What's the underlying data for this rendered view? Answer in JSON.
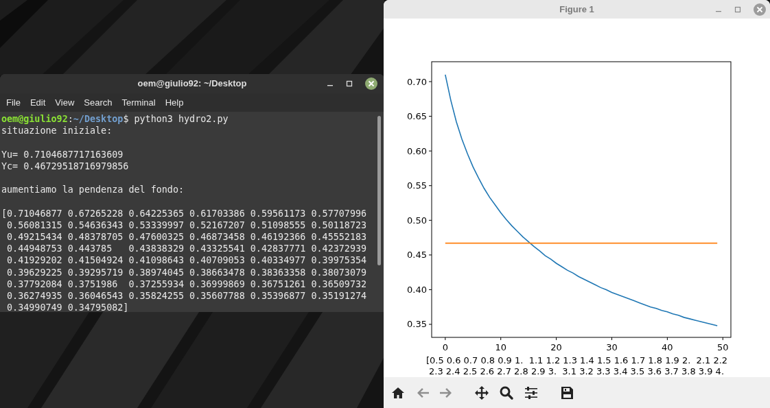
{
  "terminal": {
    "window_title": "oem@giulio92: ~/Desktop",
    "menu": [
      "File",
      "Edit",
      "View",
      "Search",
      "Terminal",
      "Help"
    ],
    "prompt": {
      "user": "oem@giulio92",
      "separator": ":",
      "path": "~/Desktop",
      "command": "$ python3 hydro2.py"
    },
    "output_blocks": [
      [
        "situazione iniziale:"
      ],
      [
        "Yu= 0.7104687717163609",
        "Yc= 0.46729518716979856"
      ],
      [
        "aumentiamo la pendenza del fondo:"
      ],
      [
        "[0.71046877 0.67265228 0.64225365 0.61703386 0.59561173 0.57707996",
        " 0.56081315 0.54636343 0.53339997 0.52167207 0.51098555 0.50118723",
        " 0.49215434 0.48378705 0.47600325 0.46873458 0.46192366 0.45552183",
        " 0.44948753 0.443785   0.43838329 0.43325541 0.42837771 0.42372939",
        " 0.41929202 0.41504924 0.41098643 0.40709053 0.40334977 0.39975354",
        " 0.39629225 0.39295719 0.38974045 0.38663478 0.38363358 0.38073079",
        " 0.37792084 0.3751986  0.37255934 0.36999869 0.36751261 0.36509732",
        " 0.36274935 0.36046543 0.35824255 0.35607788 0.35396877 0.35191274",
        " 0.34990749 0.34795082]"
      ]
    ]
  },
  "figure": {
    "window_title": "Figure 1",
    "chart_data": {
      "type": "line",
      "xlabel": "[0.5 0.6 0.7 0.8 0.9 1.  1.1 1.2 1.3 1.4 1.5 1.6 1.7 1.8 1.9 2.  2.1 2.2\n 2.3 2.4 2.5 2.6 2.7 2.8 2.9 3.  3.1 3.2 3.3 3.4 3.5 3.6 3.7 3.8 3.9 4.",
      "xlim": [
        -2.45,
        51.45
      ],
      "ylim": [
        0.3312,
        0.7287
      ],
      "xticks": [
        0,
        10,
        20,
        30,
        40,
        50
      ],
      "yticks": [
        {
          "value": 0.35,
          "label": "0.35"
        },
        {
          "value": 0.4,
          "label": "0.40"
        },
        {
          "value": 0.45,
          "label": "0.45"
        },
        {
          "value": 0.5,
          "label": "0.50"
        },
        {
          "value": 0.55,
          "label": "0.55"
        },
        {
          "value": 0.6,
          "label": "0.60"
        },
        {
          "value": 0.65,
          "label": "0.65"
        },
        {
          "value": 0.7,
          "label": "0.70"
        }
      ],
      "series": [
        {
          "color": "#1f77b4",
          "x": [
            0,
            1,
            2,
            3,
            4,
            5,
            6,
            7,
            8,
            9,
            10,
            11,
            12,
            13,
            14,
            15,
            16,
            17,
            18,
            19,
            20,
            21,
            22,
            23,
            24,
            25,
            26,
            27,
            28,
            29,
            30,
            31,
            32,
            33,
            34,
            35,
            36,
            37,
            38,
            39,
            40,
            41,
            42,
            43,
            44,
            45,
            46,
            47,
            48,
            49
          ],
          "values": [
            0.71,
            0.673,
            0.642,
            0.617,
            0.596,
            0.577,
            0.561,
            0.546,
            0.533,
            0.522,
            0.511,
            0.501,
            0.492,
            0.484,
            0.476,
            0.469,
            0.462,
            0.456,
            0.449,
            0.444,
            0.438,
            0.433,
            0.428,
            0.424,
            0.419,
            0.415,
            0.411,
            0.407,
            0.403,
            0.4,
            0.396,
            0.393,
            0.39,
            0.387,
            0.384,
            0.381,
            0.378,
            0.375,
            0.373,
            0.37,
            0.368,
            0.365,
            0.363,
            0.36,
            0.358,
            0.356,
            0.354,
            0.352,
            0.35,
            0.348
          ]
        },
        {
          "color": "#ff7f0e",
          "x": [
            0,
            49
          ],
          "values": [
            0.467,
            0.467
          ]
        }
      ]
    },
    "toolbar": [
      {
        "kind": "home",
        "disabled": false
      },
      {
        "kind": "back",
        "disabled": true
      },
      {
        "kind": "forward",
        "disabled": true
      },
      {
        "kind": "pan",
        "disabled": false
      },
      {
        "kind": "zoom",
        "disabled": false
      },
      {
        "kind": "configure",
        "disabled": false
      },
      {
        "kind": "save",
        "disabled": false
      }
    ]
  }
}
